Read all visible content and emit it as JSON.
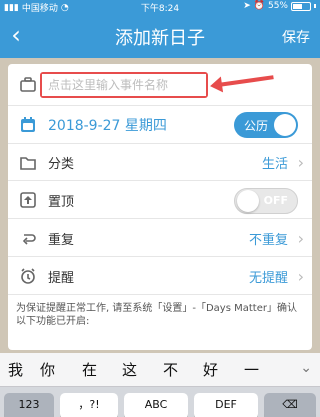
{
  "status": {
    "carrier": "中国移动",
    "time": "下午8:24",
    "battery": "55%"
  },
  "header": {
    "back_icon": "chevron-left",
    "title": "添加新日子",
    "save_label": "保存"
  },
  "form": {
    "event_name_placeholder": "点击这里输入事件名称",
    "event_name_value": "",
    "date_text": "2018-9-27 星期四",
    "calendar_toggle_label": "公历",
    "category_label": "分类",
    "category_value": "生活",
    "pin_label": "置顶",
    "pin_toggle_label": "OFF",
    "repeat_label": "重复",
    "repeat_value": "不重复",
    "reminder_label": "提醒",
    "reminder_value": "无提醒",
    "note_text": "为保证提醒正常工作, 请至系统「设置」-「Days Matter」确认以下功能已开启:"
  },
  "keyboard": {
    "candidates": [
      "我",
      "你",
      "在",
      "这",
      "不",
      "好",
      "一"
    ],
    "more_icon": "chevron-down",
    "keys": [
      "123",
      "，?!",
      "ABC",
      "DEF",
      "⌫"
    ]
  },
  "colors": {
    "accent": "#3b9ad7",
    "annotation_red": "#e74c4c"
  }
}
